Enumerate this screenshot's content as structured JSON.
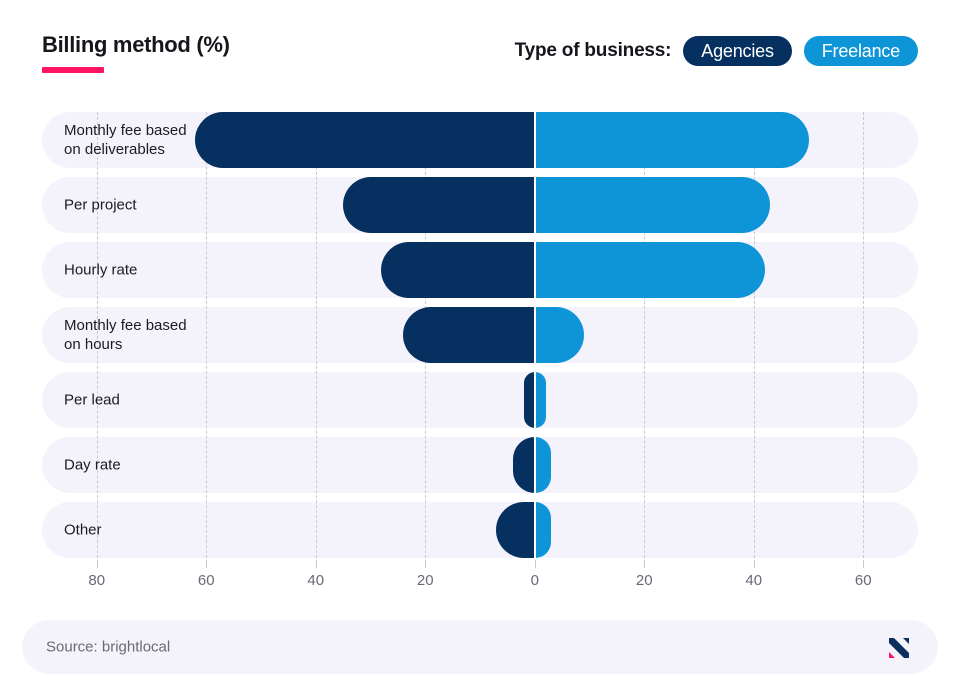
{
  "header": {
    "title": "Billing method (%)",
    "accent_color": "#ff1464",
    "legend_label": "Type of business:",
    "legend": [
      {
        "name": "Agencies",
        "color": "#06305f"
      },
      {
        "name": "Freelance",
        "color": "#0e95d8"
      }
    ]
  },
  "footer": {
    "source": "Source: brightlocal",
    "logo_name": "brand-logo-icon"
  },
  "axis": {
    "tick_labels": [
      "80",
      "60",
      "40",
      "20",
      "0",
      "20",
      "40",
      "60"
    ],
    "tick_values": [
      -80,
      -60,
      -40,
      -20,
      0,
      20,
      40,
      60
    ]
  },
  "chart_data": {
    "type": "bar",
    "orientation": "horizontal",
    "layout": "diverging",
    "title": "Billing method (%)",
    "xlabel": "",
    "ylabel": "",
    "xlim": [
      -90,
      70
    ],
    "grid": true,
    "legend_position": "top-right",
    "categories": [
      "Monthly fee based\non deliverables",
      "Per project",
      "Hourly rate",
      "Monthly fee based\non hours",
      "Per lead",
      "Day rate",
      "Other"
    ],
    "series": [
      {
        "name": "Agencies",
        "color": "#06305f",
        "side": "left",
        "values": [
          62,
          35,
          28,
          24,
          2,
          4,
          7
        ]
      },
      {
        "name": "Freelance",
        "color": "#0e95d8",
        "side": "right",
        "values": [
          50,
          43,
          42,
          9,
          2,
          3,
          3
        ]
      }
    ]
  }
}
